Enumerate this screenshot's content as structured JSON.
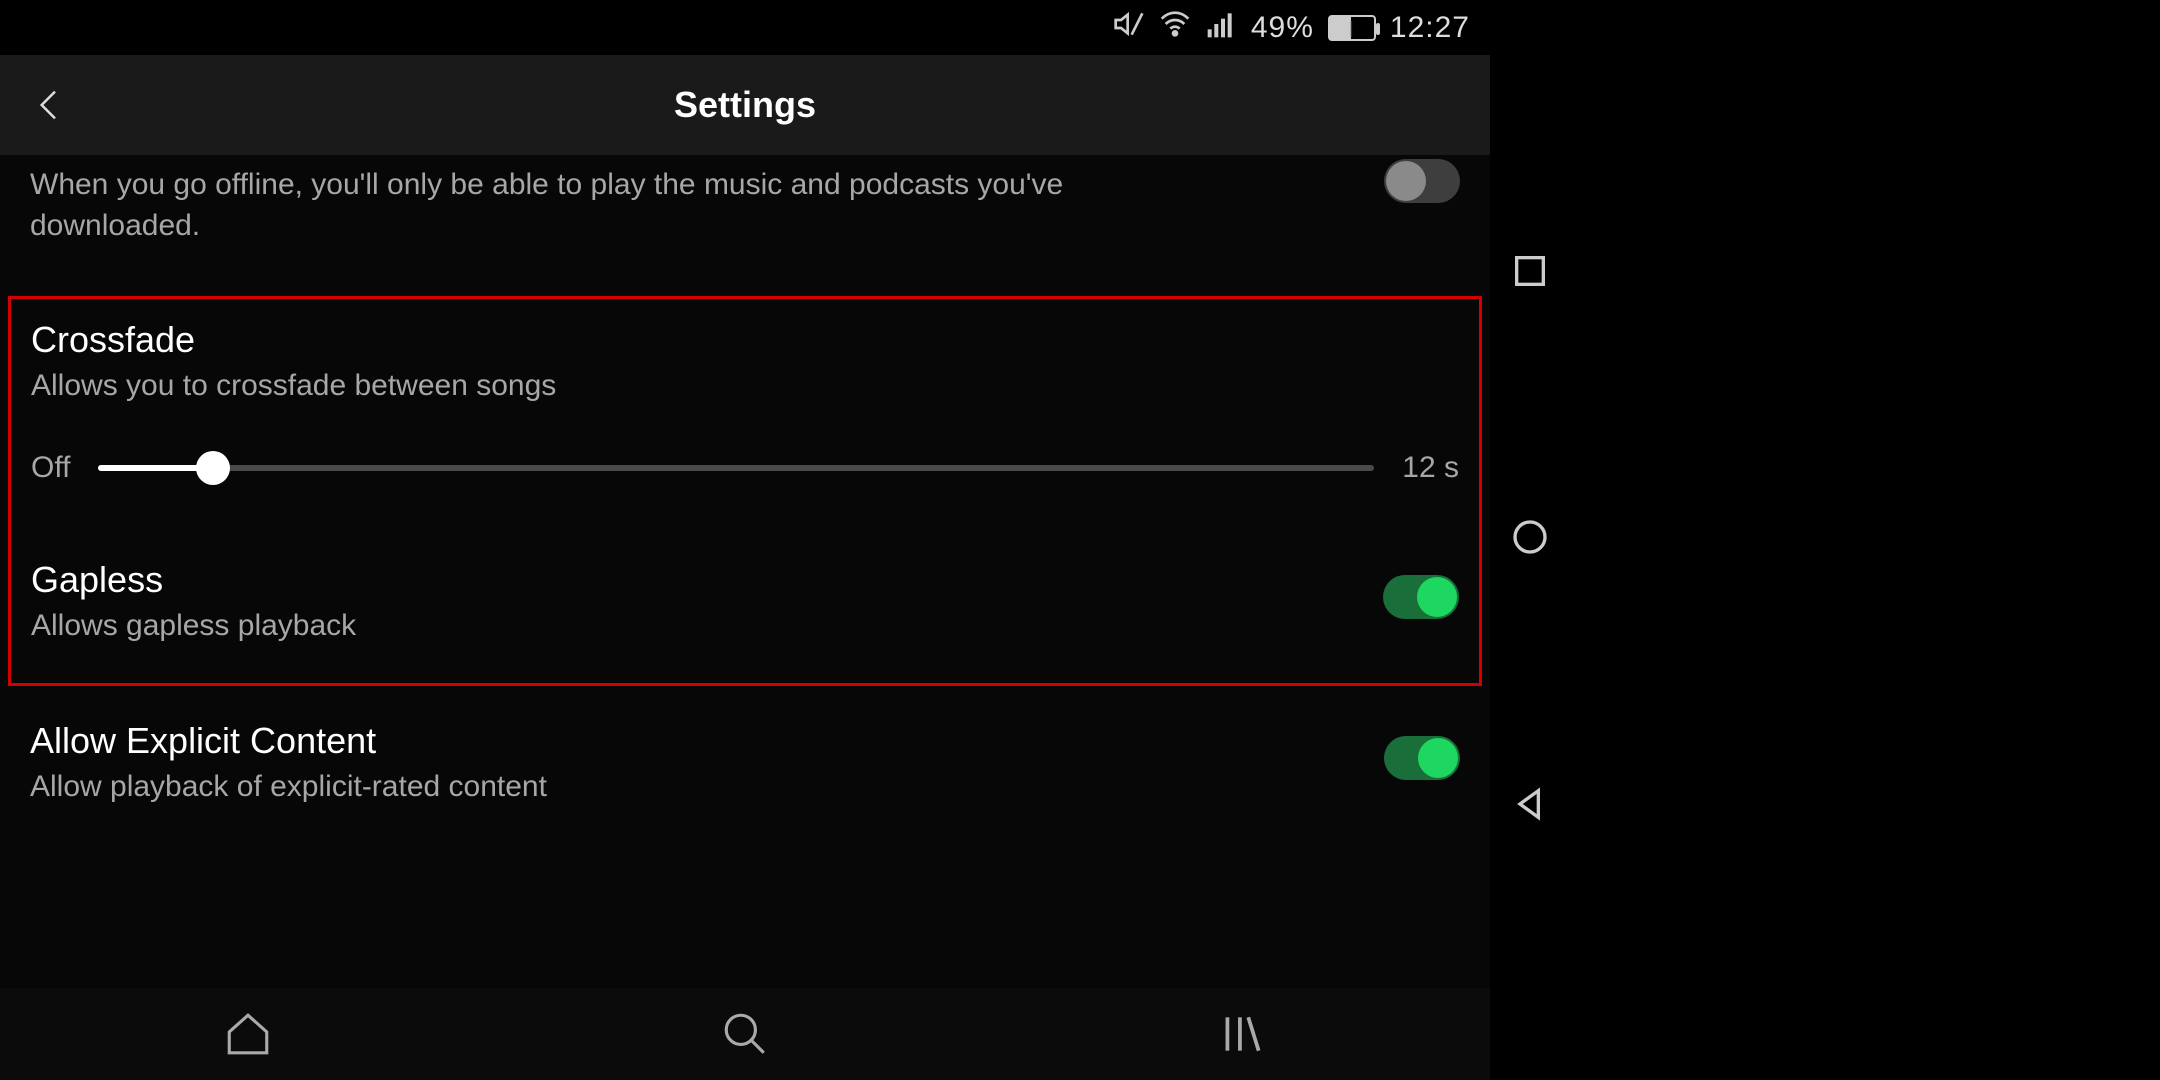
{
  "statusbar": {
    "battery_percent": "49%",
    "time": "12:27"
  },
  "header": {
    "title": "Settings"
  },
  "offline": {
    "description": "When you go offline, you'll only be able to play the music and podcasts you've downloaded.",
    "enabled": false
  },
  "crossfade": {
    "title": "Crossfade",
    "description": "Allows you to crossfade between songs",
    "min_label": "Off",
    "max_label": "12 s",
    "value_percent": 9
  },
  "gapless": {
    "title": "Gapless",
    "description": "Allows gapless playback",
    "enabled": true
  },
  "explicit": {
    "title": "Allow Explicit Content",
    "description": "Allow playback of explicit-rated content",
    "enabled": true
  }
}
